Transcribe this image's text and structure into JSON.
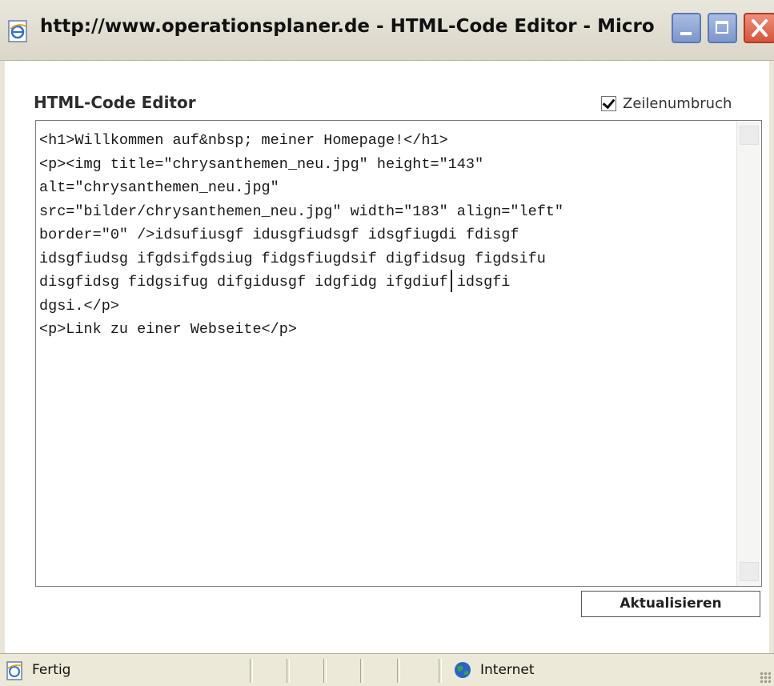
{
  "window": {
    "title": "http://www.operationsplaner.de - HTML-Code Editor - Micro...",
    "icon": "ie-page-icon",
    "controls": [
      "minimize-icon",
      "maximize-icon",
      "close-icon"
    ]
  },
  "editor": {
    "heading": "HTML-Code Editor",
    "wrap_label": "Zeilenumbruch",
    "wrap_checked": true,
    "code": "<h1>Willkommen auf&nbsp; meiner Homepage!</h1>\n<p><img title=\"chrysanthemen_neu.jpg\" height=\"143\"\nalt=\"chrysanthemen_neu.jpg\"\nsrc=\"bilder/chrysanthemen_neu.jpg\" width=\"183\" align=\"left\"\nborder=\"0\" />idsufiusgf idusgfiudsgf idsgfiugdi fdisgf\nidsgfiudsg ifgdsifgdsiug fidgsfiugdsif digfidsug figdsifu\ndisgfidsg fidgsifug difgidusgf idgfidg ifgdiuf idsgfi\ndgsi.</p>\n<p>Link zu einer Webseite</p>",
    "update_button": "Aktualisieren"
  },
  "statusbar": {
    "status": "Fertig",
    "zone": "Internet",
    "status_icon": "ie-page-icon",
    "zone_icon": "globe-icon"
  }
}
